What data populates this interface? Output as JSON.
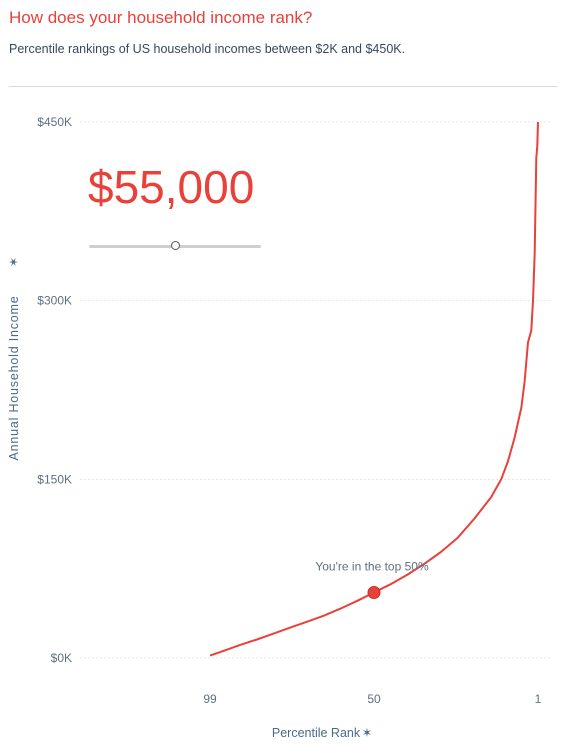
{
  "header": {
    "title": "How does your household income rank?",
    "subtitle": "Percentile rankings of US household incomes between $2K and $450K."
  },
  "control": {
    "income_value": "$55,000",
    "slider_level": 0.5
  },
  "annotation": "You're in the top 50%",
  "colors": {
    "accent": "#e8413a",
    "text": "#35495e",
    "axis": "#5f6f80",
    "grid": "#e6e6e6"
  },
  "chart_data": {
    "type": "line",
    "xlabel": "Percentile Rank",
    "xlabel_icon": "sort-icon",
    "ylabel": "Annual Household Income",
    "ylabel_icon": "sort-icon",
    "x_reversed": true,
    "xlim": [
      100,
      1
    ],
    "ylim": [
      0,
      450000
    ],
    "x_ticks": [
      {
        "value": 99,
        "label": "99"
      },
      {
        "value": 50,
        "label": "50"
      },
      {
        "value": 1,
        "label": "1"
      }
    ],
    "y_ticks": [
      {
        "value": 0,
        "label": "$0K"
      },
      {
        "value": 150000,
        "label": "$150K"
      },
      {
        "value": 300000,
        "label": "$300K"
      },
      {
        "value": 450000,
        "label": "$450K"
      }
    ],
    "grid": true,
    "series": [
      {
        "x": [
          99,
          95,
          90,
          85,
          80,
          75,
          70,
          65,
          60,
          55,
          50,
          45,
          40,
          35,
          30,
          25,
          20,
          15,
          12,
          10,
          8,
          6,
          5,
          4,
          3,
          2.5,
          2,
          1.5,
          1.2,
          1
        ],
        "y": [
          2000,
          6000,
          11000,
          15500,
          20500,
          25500,
          30500,
          35500,
          41500,
          48000,
          55000,
          62000,
          70000,
          79000,
          89000,
          101000,
          117000,
          135000,
          150000,
          165000,
          185000,
          210000,
          232000,
          265000,
          275000,
          300000,
          340000,
          420000,
          430000,
          450000
        ]
      }
    ],
    "highlight": {
      "x": 50,
      "y": 55000
    }
  }
}
